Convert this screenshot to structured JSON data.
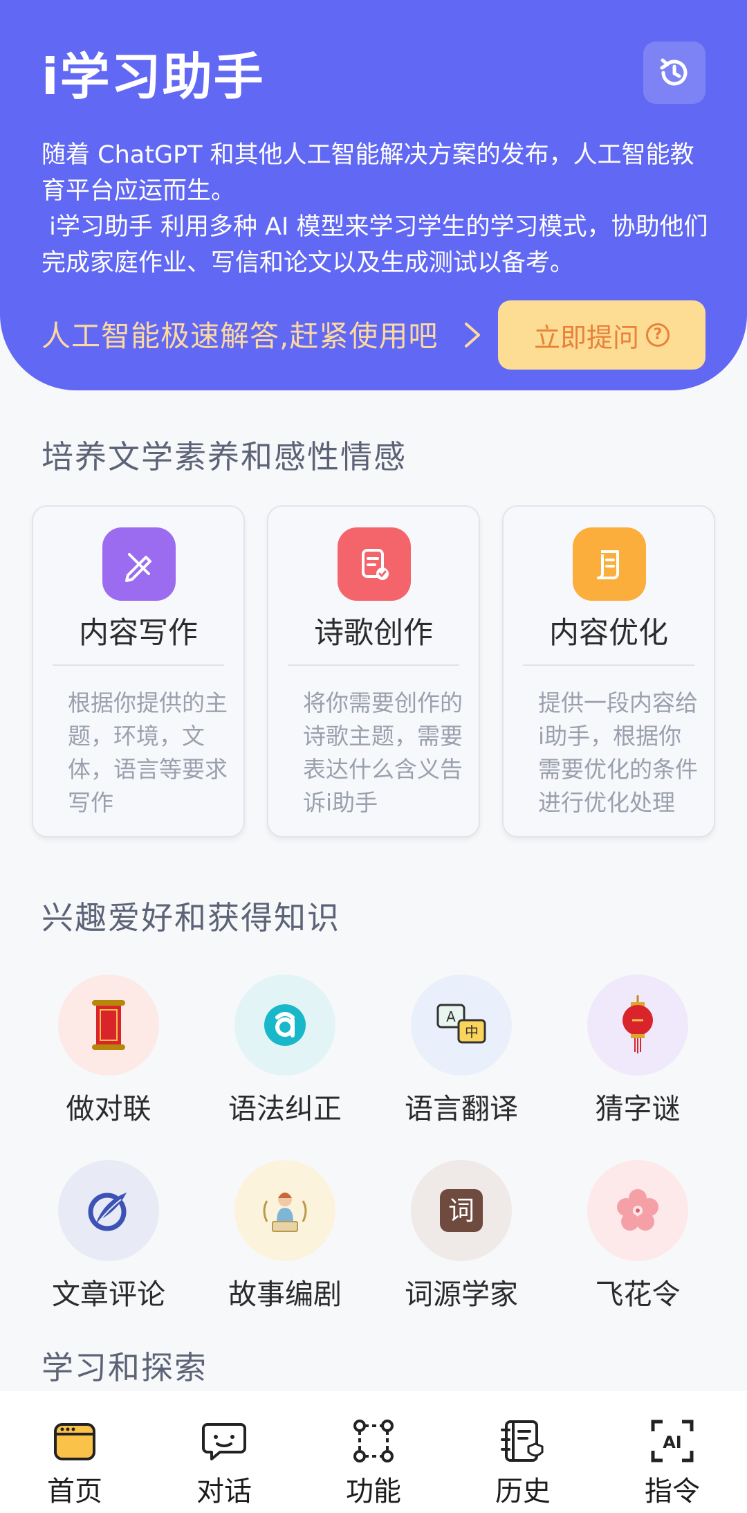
{
  "header": {
    "title": "i学习助手",
    "intro_line1": "随着 ChatGPT 和其他人工智能解决方案的发布，人工智能教育平台应运而生。",
    "intro_line2": " i学习助手 利用多种 AI 模型来学习学生的学习模式，协助他们完成家庭作业、写信和论文以及生成测试以备考。",
    "cta_text": "人工智能极速解答,赶紧使用吧",
    "ask_button": "立即提问",
    "history_icon": "history-icon"
  },
  "section1": {
    "title": "培养文学素养和感性情感",
    "cards": [
      {
        "title": "内容写作",
        "desc": "根据你提供的主题，环境，文体，语言等要求写作",
        "color": "#9b6cf0",
        "icon": "pen-icon"
      },
      {
        "title": "诗歌创作",
        "desc": "将你需要创作的诗歌主题，需要表达什么含义告诉i助手",
        "color": "#f3646b",
        "icon": "document-icon"
      },
      {
        "title": "内容优化",
        "desc": "提供一段内容给i助手，根据你需要优化的条件进行优化处理",
        "color": "#fbae3c",
        "icon": "scroll-icon"
      }
    ]
  },
  "section2": {
    "title": "兴趣爱好和获得知识",
    "features": [
      {
        "label": "做对联",
        "bg": "#fde9e6",
        "icon": "couplet-scroll-icon"
      },
      {
        "label": "语法纠正",
        "bg": "#e2f4f6",
        "icon": "letter-a-icon"
      },
      {
        "label": "语言翻译",
        "bg": "#eaf0fb",
        "icon": "translate-icon"
      },
      {
        "label": "猜字谜",
        "bg": "#f0e9fb",
        "icon": "lantern-icon"
      },
      {
        "label": "文章评论",
        "bg": "#e8eaf6",
        "icon": "feather-icon"
      },
      {
        "label": "故事编剧",
        "bg": "#fcf3dd",
        "icon": "storyteller-icon"
      },
      {
        "label": "词源学家",
        "bg": "#efe9e7",
        "icon": "word-icon"
      },
      {
        "label": "飞花令",
        "bg": "#fde9ea",
        "icon": "flower-icon"
      }
    ],
    "word_glyph": "词"
  },
  "section3": {
    "title": "学习和探索"
  },
  "nav": {
    "items": [
      {
        "label": "首页",
        "icon": "home-icon"
      },
      {
        "label": "对话",
        "icon": "chat-icon"
      },
      {
        "label": "功能",
        "icon": "functions-icon"
      },
      {
        "label": "历史",
        "icon": "history-book-icon"
      },
      {
        "label": "指令",
        "icon": "ai-command-icon"
      }
    ],
    "ai_badge": "AI"
  },
  "translate_badge": {
    "a": "A",
    "zh": "中"
  }
}
